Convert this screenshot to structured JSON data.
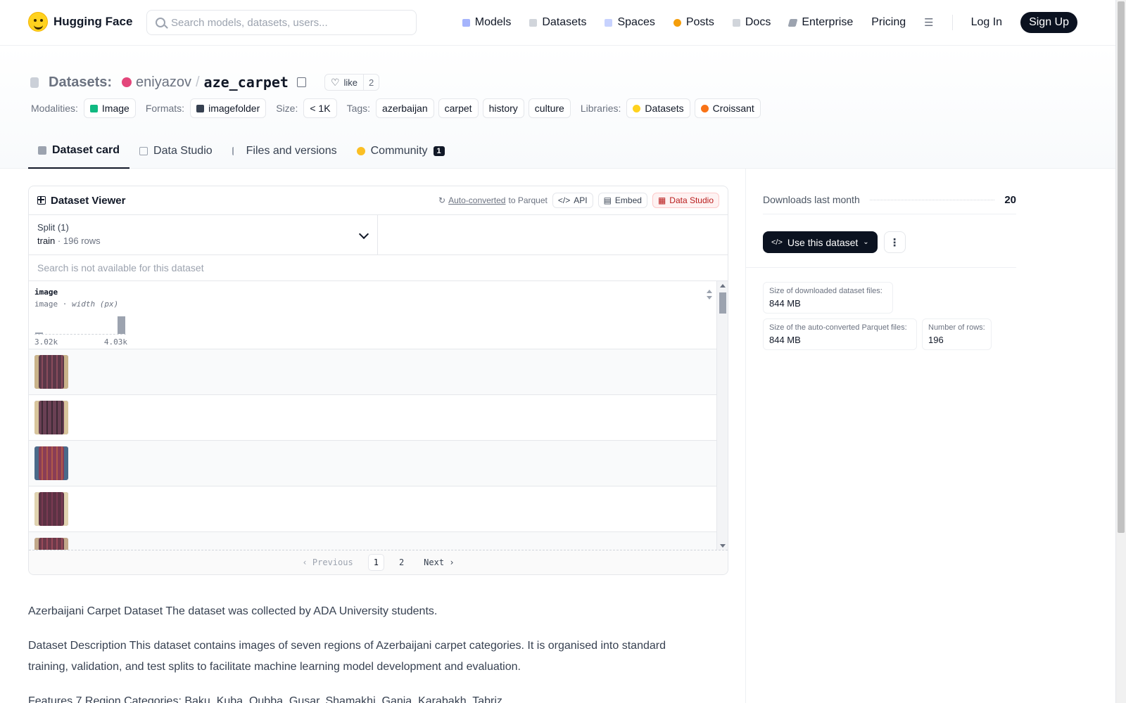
{
  "header": {
    "brand": "Hugging Face",
    "search_placeholder": "Search models, datasets, users...",
    "nav": [
      {
        "label": "Models",
        "color": "#a5b4fc"
      },
      {
        "label": "Datasets",
        "color": "#d1d5db"
      },
      {
        "label": "Spaces",
        "color": "#c7d2fe"
      },
      {
        "label": "Posts",
        "color": "#f59e0b"
      },
      {
        "label": "Docs",
        "color": "#d1d5db"
      },
      {
        "label": "Enterprise",
        "color": "#9ca3af"
      },
      {
        "label": "Pricing"
      }
    ],
    "login": "Log In",
    "signup": "Sign Up"
  },
  "dataset": {
    "type_label": "Datasets:",
    "owner": "eniyazov",
    "slash": "/",
    "name": "aze_carpet",
    "like_label": "like",
    "like_count": "2"
  },
  "tags": {
    "modalities_label": "Modalities:",
    "modality": "Image",
    "formats_label": "Formats:",
    "format": "imagefolder",
    "size_label": "Size:",
    "size": "< 1K",
    "tags_label": "Tags:",
    "tags": [
      "azerbaijan",
      "carpet",
      "history",
      "culture"
    ],
    "libraries_label": "Libraries:",
    "libraries": [
      "Datasets",
      "Croissant"
    ]
  },
  "tabs": [
    {
      "label": "Dataset card",
      "active": true
    },
    {
      "label": "Data Studio"
    },
    {
      "label": "Files and versions"
    },
    {
      "label": "Community",
      "badge": "1"
    }
  ],
  "viewer": {
    "title": "Dataset Viewer",
    "auto_converted": "Auto-converted",
    "to_parquet": "to Parquet",
    "api": "API",
    "embed": "Embed",
    "data_studio": "Data Studio",
    "split_label": "Split (1)",
    "split_name": "train",
    "split_dot": "·",
    "split_rows": "196 rows",
    "search_na": "Search is not available for this dataset",
    "column": {
      "name": "image",
      "type": "image",
      "type_sep": "·",
      "stat": "width (px)",
      "hist_min": "3.02k",
      "hist_max": "4.03k",
      "hist_bins": [
        0.05,
        0,
        0,
        0,
        0,
        0,
        0,
        0,
        0,
        0.95
      ]
    },
    "rows": [
      {
        "thumb_colors": [
          "#5a3848",
          "#c9b38a",
          "#8a4b5c"
        ]
      },
      {
        "thumb_colors": [
          "#6a4054",
          "#d8c59c",
          "#3e2a36"
        ]
      },
      {
        "thumb_colors": [
          "#8a3d56",
          "#4a6a8a",
          "#b05a4a"
        ]
      },
      {
        "thumb_colors": [
          "#5c3244",
          "#e0d3b0",
          "#7a3a52"
        ]
      },
      {
        "thumb_colors": [
          "#6a3a4a",
          "#c2a88a",
          "#9a4a5a"
        ]
      }
    ],
    "pager": {
      "prev": "Previous",
      "pages": [
        "1",
        "2"
      ],
      "current": "1",
      "next": "Next"
    }
  },
  "card": {
    "paragraphs": [
      "Azerbaijani Carpet Dataset The dataset was collected by ADA University students.",
      "Dataset Description This dataset contains images of seven regions of Azerbaijani carpet categories. It is organised into standard training, validation, and test splits to facilitate machine learning model development and evaluation.",
      "Features 7 Region Categories: Baku, Kuba, Qubba, Gusar, Shamakhi, Ganja, Karabakh, Tabriz..."
    ]
  },
  "side": {
    "downloads_label": "Downloads last month",
    "downloads_value": "20",
    "use_button": "Use this dataset",
    "size_downloaded_label": "Size of downloaded dataset files:",
    "size_downloaded": "844 MB",
    "size_parquet_label": "Size of the auto-converted Parquet files:",
    "size_parquet": "844 MB",
    "rows_label": "Number of rows:",
    "rows_value": "196"
  }
}
